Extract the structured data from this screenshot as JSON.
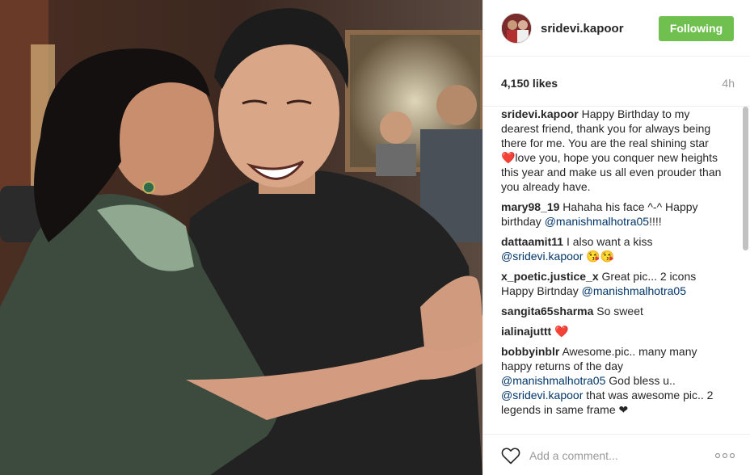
{
  "header": {
    "username": "sridevi.kapoor",
    "follow_label": "Following"
  },
  "meta": {
    "likes": "4,150 likes",
    "time": "4h"
  },
  "comments": [
    {
      "author": "sridevi.kapoor",
      "text": "Happy Birthday to my dearest friend, thank you for always being there for me. You are the real shining star ❤️love you, hope you conquer new heights this year and make us all even prouder than you already have."
    },
    {
      "author": "mary98_19",
      "text": "Hahaha his face ^-^ Happy birthday ",
      "mention": "@manishmalhotra05",
      "after": "!!!!"
    },
    {
      "author": "dattaamit11",
      "text": "I also want a kiss ",
      "mention": "@sridevi.kapoor",
      "after": " 😘😘"
    },
    {
      "author": "x_poetic.justice_x",
      "text": "Great pic... 2 icons Happy Birtnday ",
      "mention": "@manishmalhotra05",
      "after": ""
    },
    {
      "author": "sangita65sharma",
      "text": "So sweet",
      "mention": "",
      "after": ""
    },
    {
      "author": "ialinajuttt",
      "text": "❤️",
      "mention": "",
      "after": ""
    },
    {
      "author": "bobbyinblr",
      "text": "Awesome.pic.. many many happy returns of the day ",
      "mention": "@manishmalhotra05",
      "after": " God bless u.. ",
      "mention2": "@sridevi.kapoor",
      "after2": " that was awesome pic.. 2 legends in same frame ❤"
    }
  ],
  "footer": {
    "comment_placeholder": "Add a comment..."
  },
  "icons": {
    "like": "heart-outline-icon",
    "more": "more-options-icon"
  },
  "colors": {
    "follow_button": "#70c050",
    "mention": "#003569",
    "secondary_text": "#999999"
  }
}
